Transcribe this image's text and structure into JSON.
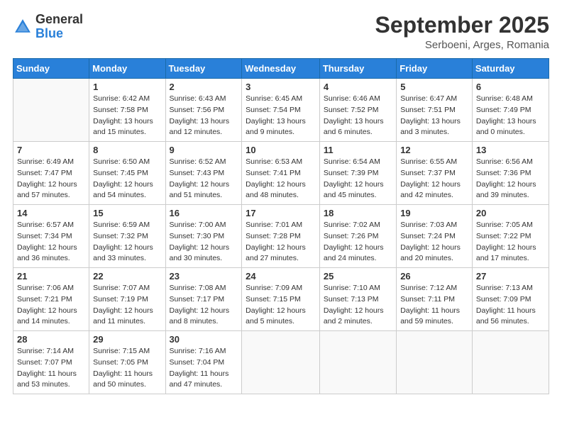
{
  "header": {
    "logo_general": "General",
    "logo_blue": "Blue",
    "month_title": "September 2025",
    "location": "Serboeni, Arges, Romania"
  },
  "weekdays": [
    "Sunday",
    "Monday",
    "Tuesday",
    "Wednesday",
    "Thursday",
    "Friday",
    "Saturday"
  ],
  "weeks": [
    [
      {
        "day": "",
        "info": ""
      },
      {
        "day": "1",
        "info": "Sunrise: 6:42 AM\nSunset: 7:58 PM\nDaylight: 13 hours\nand 15 minutes."
      },
      {
        "day": "2",
        "info": "Sunrise: 6:43 AM\nSunset: 7:56 PM\nDaylight: 13 hours\nand 12 minutes."
      },
      {
        "day": "3",
        "info": "Sunrise: 6:45 AM\nSunset: 7:54 PM\nDaylight: 13 hours\nand 9 minutes."
      },
      {
        "day": "4",
        "info": "Sunrise: 6:46 AM\nSunset: 7:52 PM\nDaylight: 13 hours\nand 6 minutes."
      },
      {
        "day": "5",
        "info": "Sunrise: 6:47 AM\nSunset: 7:51 PM\nDaylight: 13 hours\nand 3 minutes."
      },
      {
        "day": "6",
        "info": "Sunrise: 6:48 AM\nSunset: 7:49 PM\nDaylight: 13 hours\nand 0 minutes."
      }
    ],
    [
      {
        "day": "7",
        "info": "Sunrise: 6:49 AM\nSunset: 7:47 PM\nDaylight: 12 hours\nand 57 minutes."
      },
      {
        "day": "8",
        "info": "Sunrise: 6:50 AM\nSunset: 7:45 PM\nDaylight: 12 hours\nand 54 minutes."
      },
      {
        "day": "9",
        "info": "Sunrise: 6:52 AM\nSunset: 7:43 PM\nDaylight: 12 hours\nand 51 minutes."
      },
      {
        "day": "10",
        "info": "Sunrise: 6:53 AM\nSunset: 7:41 PM\nDaylight: 12 hours\nand 48 minutes."
      },
      {
        "day": "11",
        "info": "Sunrise: 6:54 AM\nSunset: 7:39 PM\nDaylight: 12 hours\nand 45 minutes."
      },
      {
        "day": "12",
        "info": "Sunrise: 6:55 AM\nSunset: 7:37 PM\nDaylight: 12 hours\nand 42 minutes."
      },
      {
        "day": "13",
        "info": "Sunrise: 6:56 AM\nSunset: 7:36 PM\nDaylight: 12 hours\nand 39 minutes."
      }
    ],
    [
      {
        "day": "14",
        "info": "Sunrise: 6:57 AM\nSunset: 7:34 PM\nDaylight: 12 hours\nand 36 minutes."
      },
      {
        "day": "15",
        "info": "Sunrise: 6:59 AM\nSunset: 7:32 PM\nDaylight: 12 hours\nand 33 minutes."
      },
      {
        "day": "16",
        "info": "Sunrise: 7:00 AM\nSunset: 7:30 PM\nDaylight: 12 hours\nand 30 minutes."
      },
      {
        "day": "17",
        "info": "Sunrise: 7:01 AM\nSunset: 7:28 PM\nDaylight: 12 hours\nand 27 minutes."
      },
      {
        "day": "18",
        "info": "Sunrise: 7:02 AM\nSunset: 7:26 PM\nDaylight: 12 hours\nand 24 minutes."
      },
      {
        "day": "19",
        "info": "Sunrise: 7:03 AM\nSunset: 7:24 PM\nDaylight: 12 hours\nand 20 minutes."
      },
      {
        "day": "20",
        "info": "Sunrise: 7:05 AM\nSunset: 7:22 PM\nDaylight: 12 hours\nand 17 minutes."
      }
    ],
    [
      {
        "day": "21",
        "info": "Sunrise: 7:06 AM\nSunset: 7:21 PM\nDaylight: 12 hours\nand 14 minutes."
      },
      {
        "day": "22",
        "info": "Sunrise: 7:07 AM\nSunset: 7:19 PM\nDaylight: 12 hours\nand 11 minutes."
      },
      {
        "day": "23",
        "info": "Sunrise: 7:08 AM\nSunset: 7:17 PM\nDaylight: 12 hours\nand 8 minutes."
      },
      {
        "day": "24",
        "info": "Sunrise: 7:09 AM\nSunset: 7:15 PM\nDaylight: 12 hours\nand 5 minutes."
      },
      {
        "day": "25",
        "info": "Sunrise: 7:10 AM\nSunset: 7:13 PM\nDaylight: 12 hours\nand 2 minutes."
      },
      {
        "day": "26",
        "info": "Sunrise: 7:12 AM\nSunset: 7:11 PM\nDaylight: 11 hours\nand 59 minutes."
      },
      {
        "day": "27",
        "info": "Sunrise: 7:13 AM\nSunset: 7:09 PM\nDaylight: 11 hours\nand 56 minutes."
      }
    ],
    [
      {
        "day": "28",
        "info": "Sunrise: 7:14 AM\nSunset: 7:07 PM\nDaylight: 11 hours\nand 53 minutes."
      },
      {
        "day": "29",
        "info": "Sunrise: 7:15 AM\nSunset: 7:05 PM\nDaylight: 11 hours\nand 50 minutes."
      },
      {
        "day": "30",
        "info": "Sunrise: 7:16 AM\nSunset: 7:04 PM\nDaylight: 11 hours\nand 47 minutes."
      },
      {
        "day": "",
        "info": ""
      },
      {
        "day": "",
        "info": ""
      },
      {
        "day": "",
        "info": ""
      },
      {
        "day": "",
        "info": ""
      }
    ]
  ]
}
